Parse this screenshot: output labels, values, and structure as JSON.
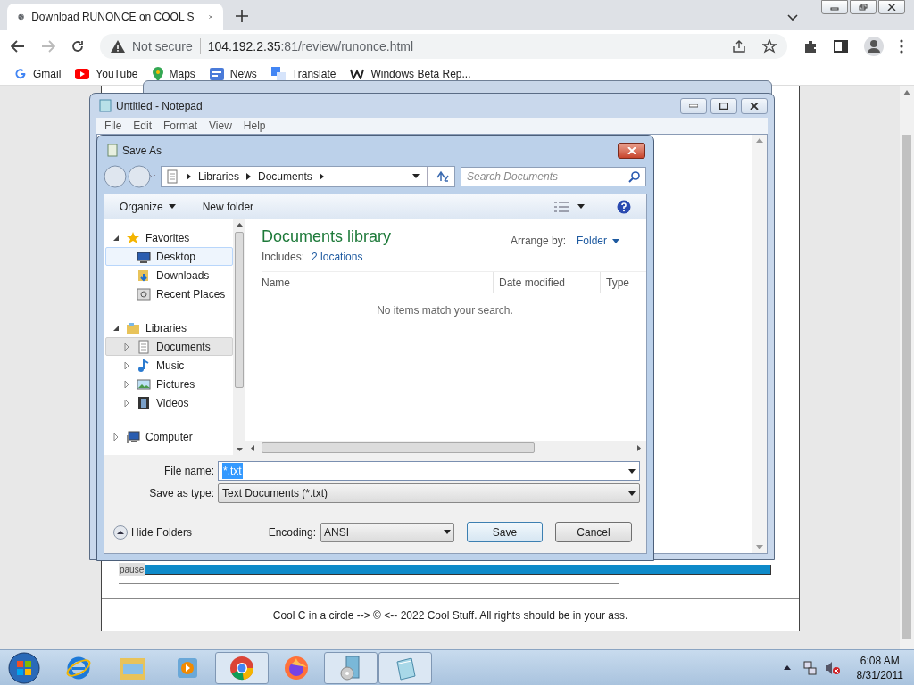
{
  "browser": {
    "tab": {
      "title": "Download RUNONCE on COOL S"
    },
    "address": {
      "security": "Not secure",
      "host": "104.192.2.35",
      "path": ":81/review/runonce.html"
    },
    "bookmarks": [
      {
        "label": "Gmail",
        "kind": "g"
      },
      {
        "label": "YouTube",
        "kind": "yt"
      },
      {
        "label": "Maps",
        "kind": "maps"
      },
      {
        "label": "News",
        "kind": "news"
      },
      {
        "label": "Translate",
        "kind": "translate"
      },
      {
        "label": "Windows Beta Rep...",
        "kind": "w"
      }
    ]
  },
  "page": {
    "progress_label": "pause",
    "footer": "Cool C in a circle --> © <-- 2022 Cool Stuff. All rights should be in your ass."
  },
  "notepad": {
    "title": "Untitled - Notepad",
    "menu": [
      "File",
      "Edit",
      "Format",
      "View",
      "Help"
    ]
  },
  "save_as": {
    "title": "Save As",
    "breadcrumb": [
      "Libraries",
      "Documents"
    ],
    "search": {
      "placeholder": "Search Documents"
    },
    "toolbar": [
      "Organize",
      "New folder"
    ],
    "tree": [
      {
        "label": "Favorites",
        "kind": "star",
        "expanded": true,
        "selected": false,
        "hovered": false,
        "children": [
          {
            "label": "Desktop",
            "kind": "desktop",
            "selected": false,
            "hovered": true
          },
          {
            "label": "Downloads",
            "kind": "downloads",
            "selected": false,
            "hovered": false
          },
          {
            "label": "Recent Places",
            "kind": "recent",
            "selected": false,
            "hovered": false
          }
        ]
      },
      {
        "label": "Libraries",
        "kind": "libraries",
        "expanded": true,
        "selected": false,
        "hovered": false,
        "children": [
          {
            "label": "Documents",
            "kind": "documents",
            "expanded": false,
            "selected": true,
            "hovered": false
          },
          {
            "label": "Music",
            "kind": "music",
            "expanded": false,
            "selected": false,
            "hovered": false
          },
          {
            "label": "Pictures",
            "kind": "pictures",
            "expanded": false,
            "selected": false,
            "hovered": false
          },
          {
            "label": "Videos",
            "kind": "videos",
            "expanded": false,
            "selected": false,
            "hovered": false
          }
        ]
      },
      {
        "label": "Computer",
        "kind": "computer",
        "expanded": false,
        "selected": false,
        "hovered": false
      }
    ],
    "content": {
      "heading": "Documents library",
      "includes_label": "Includes:",
      "includes_link": "2 locations",
      "arrange_label": "Arrange by:",
      "arrange_value": "Folder",
      "columns": [
        "Name",
        "Date modified",
        "Type"
      ],
      "empty": "No items match your search."
    },
    "file_name": {
      "label": "File name:",
      "value": "*.txt"
    },
    "save_type": {
      "label": "Save as type:",
      "value": "Text Documents (*.txt)"
    },
    "hide_folders": "Hide Folders",
    "encoding": {
      "label": "Encoding:",
      "value": "ANSI"
    },
    "buttons": [
      "Save",
      "Cancel"
    ]
  },
  "taskbar": {
    "apps": [
      {
        "kind": "ie",
        "open": false
      },
      {
        "kind": "explorer",
        "open": false
      },
      {
        "kind": "media",
        "open": false
      },
      {
        "kind": "chrome",
        "open": true
      },
      {
        "kind": "firefox",
        "open": false
      },
      {
        "kind": "installer",
        "open": true
      },
      {
        "kind": "notepad",
        "open": true
      }
    ],
    "time": "6:08 AM",
    "date": "8/31/2011"
  }
}
